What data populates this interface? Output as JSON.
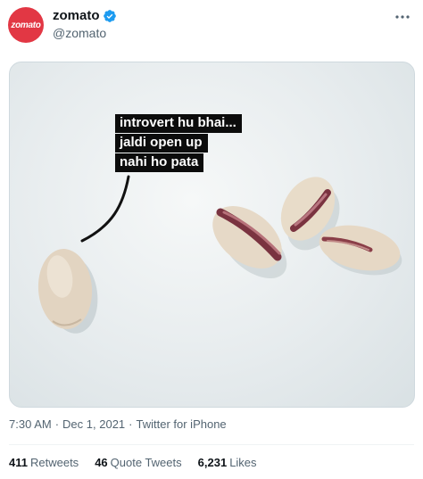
{
  "header": {
    "avatar_text": "zomato",
    "display_name": "zomato",
    "handle": "@zomato",
    "brand_color": "#e23744",
    "verified_color": "#1d9bf0"
  },
  "media": {
    "caption_lines": [
      "introvert hu bhai...",
      "jaldi open up",
      "nahi ho pata"
    ]
  },
  "meta": {
    "time": "7:30 AM",
    "date": "Dec 1, 2021",
    "source": "Twitter for iPhone",
    "separator": "·"
  },
  "stats": {
    "retweets_count": "411",
    "retweets_label": "Retweets",
    "quote_count": "46",
    "quote_label": "Quote Tweets",
    "likes_count": "6,231",
    "likes_label": "Likes"
  }
}
